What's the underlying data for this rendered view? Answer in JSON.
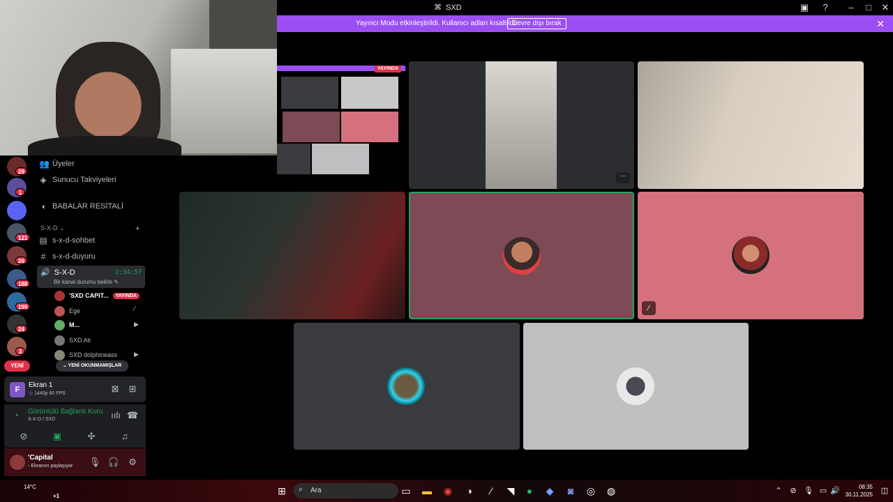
{
  "window": {
    "title": "SXD"
  },
  "banner": {
    "message": "Yayıncı Modu etkinleştirildi. Kullanıcı adları kısaltıldı.",
    "button": "Devre dışı bırak"
  },
  "preview": {
    "live_label": "YAYINDA"
  },
  "guilds": [
    {
      "badge": "29",
      "color": "#6b2b2b"
    },
    {
      "badge": "1",
      "color": "#5a4e9a"
    },
    {
      "badge": "",
      "color": "#5865f2"
    },
    {
      "badge": "121",
      "color": "#4a5566"
    },
    {
      "badge": "26",
      "color": "#7a3a3a"
    },
    {
      "badge": "188",
      "color": "#3b5b8a"
    },
    {
      "badge": "199",
      "color": "#2d6aa0"
    },
    {
      "badge": "24",
      "color": "#333"
    },
    {
      "badge": "3",
      "color": "#9a5a4a"
    }
  ],
  "new_pill": "YENİ",
  "channels": {
    "members": "Üyeler",
    "boosts": "Sunucu Takviyeleri",
    "stage": "BABALAR RESİTALİ",
    "category": "S-X-D",
    "text1": "s-x-d-sohbet",
    "text2": "s-x-d-duyuru",
    "voice_name": "S-X-D",
    "voice_timer": "2:34:57",
    "voice_status": "Bir kanal durumu belirle",
    "users": [
      {
        "name": "'SXD CAPIT...",
        "live": "YAYINDA"
      },
      {
        "name": "Ege"
      },
      {
        "name": "M..."
      },
      {
        "name": "SXD Ati"
      },
      {
        "name": "SXD dolphineass"
      }
    ],
    "unread": "YENİ OKUNMAMIŞLAR"
  },
  "screen_panel": {
    "name": "Ekran 1",
    "quality": "1440p 60 FPS",
    "letter": "F"
  },
  "voice_panel": {
    "status": "Görüntülü Bağlantı Kuru",
    "channel": "S-X-D / SXD"
  },
  "user_panel": {
    "name": "'Capital",
    "status": "Ekranını paylaşıyor"
  },
  "taskbar": {
    "search": "Ara",
    "temp": "14°C",
    "weather_sub": "...",
    "time": "08:35",
    "date": "30.11.2025",
    "notif": "+1"
  },
  "colors": {
    "accent": "#9b4ff3",
    "live": "#e0314a",
    "tile_dark": "#3a3b3f",
    "tile_rose": "#7d4a55",
    "tile_pink": "#d4717d",
    "tile_light": "#bfbfc2"
  }
}
